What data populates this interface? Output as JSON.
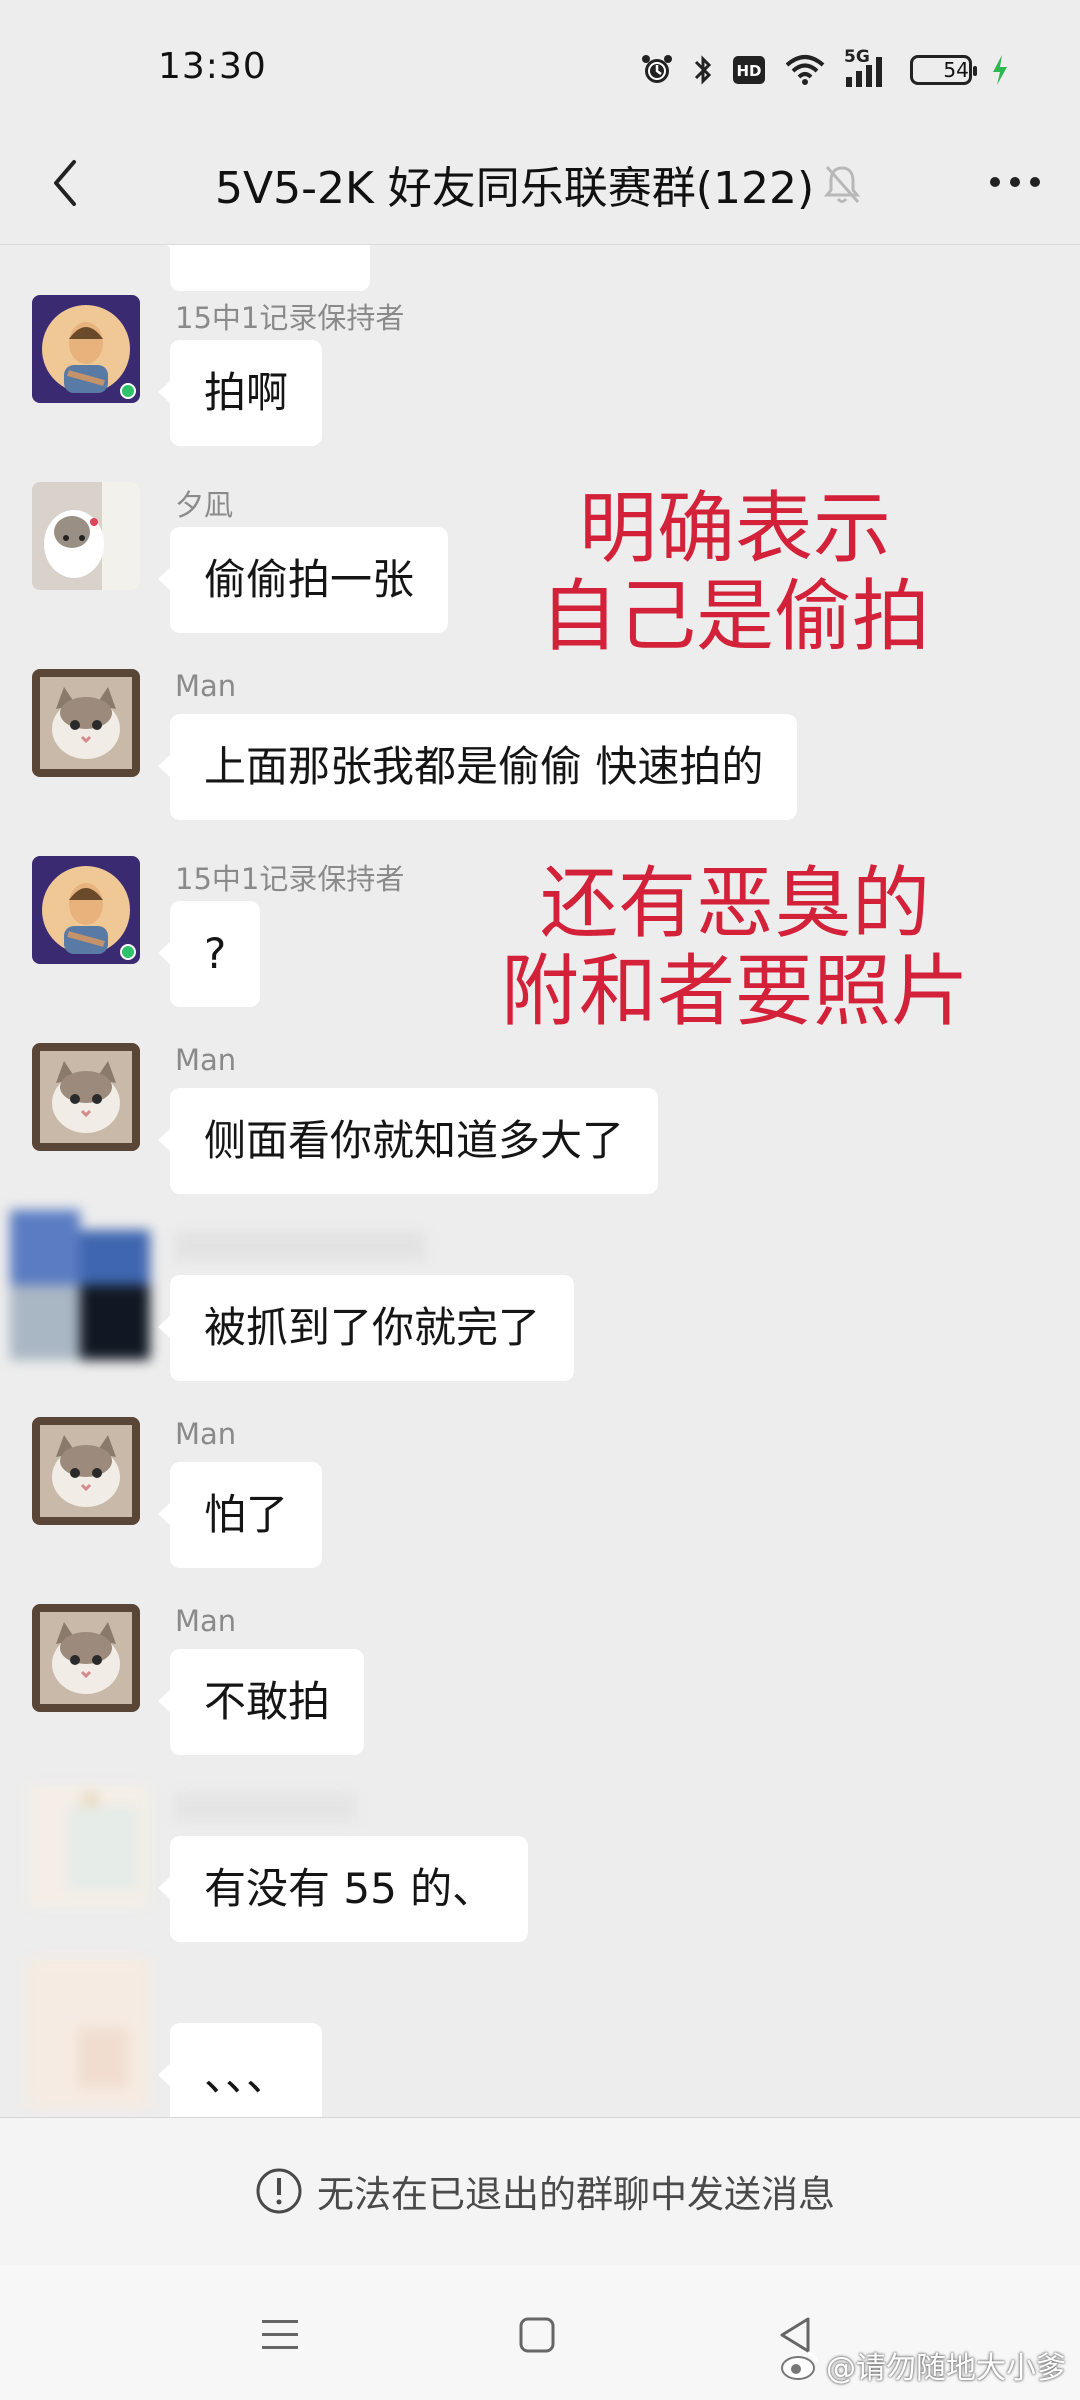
{
  "status_bar": {
    "time": "13:30",
    "network": "5G",
    "hd_label": "HD",
    "battery_level": "54",
    "battery_fraction": 0.54,
    "icons": [
      "alarm-icon",
      "bluetooth-icon",
      "hd-icon",
      "wifi-icon",
      "signal-5g-icon",
      "battery-icon",
      "charging-icon"
    ]
  },
  "nav": {
    "title": "5V5-2K 好友同乐联赛群(122)",
    "icons": [
      "back-chevron-icon",
      "mute-bell-icon",
      "more-dots-icon"
    ]
  },
  "messages": [
    {
      "sender": "15中1记录保持者",
      "text": "拍啊"
    },
    {
      "sender": "夕凪",
      "text": "偷偷拍一张"
    },
    {
      "sender": "Man",
      "text": "上面那张我都是偷偷 快速拍的"
    },
    {
      "sender": "15中1记录保持者",
      "text": "?"
    },
    {
      "sender": "Man",
      "text": "侧面看你就知道多大了"
    },
    {
      "sender": "",
      "text": "被抓到了你就完了"
    },
    {
      "sender": "Man",
      "text": "怕了"
    },
    {
      "sender": "Man",
      "text": "不敢拍"
    },
    {
      "sender": "",
      "text": "有没有  55 的、"
    },
    {
      "sender": "",
      "text": "、、、"
    }
  ],
  "annotations": [
    {
      "lines": [
        "明确表示",
        "自己是偷拍"
      ]
    },
    {
      "lines": [
        "还有恶臭的",
        "附和者要照片"
      ]
    }
  ],
  "input_bar": {
    "notice": "无法在已退出的群聊中发送消息"
  },
  "system_nav": {
    "icons": [
      "menu-icon",
      "home-square-icon",
      "back-triangle-icon"
    ]
  },
  "watermark": "@请勿随地大小爹",
  "colors": {
    "background": "#ededed",
    "bubble": "#ffffff",
    "annotation_red": "#d4213a",
    "sender_gray": "#8a8a8a"
  }
}
